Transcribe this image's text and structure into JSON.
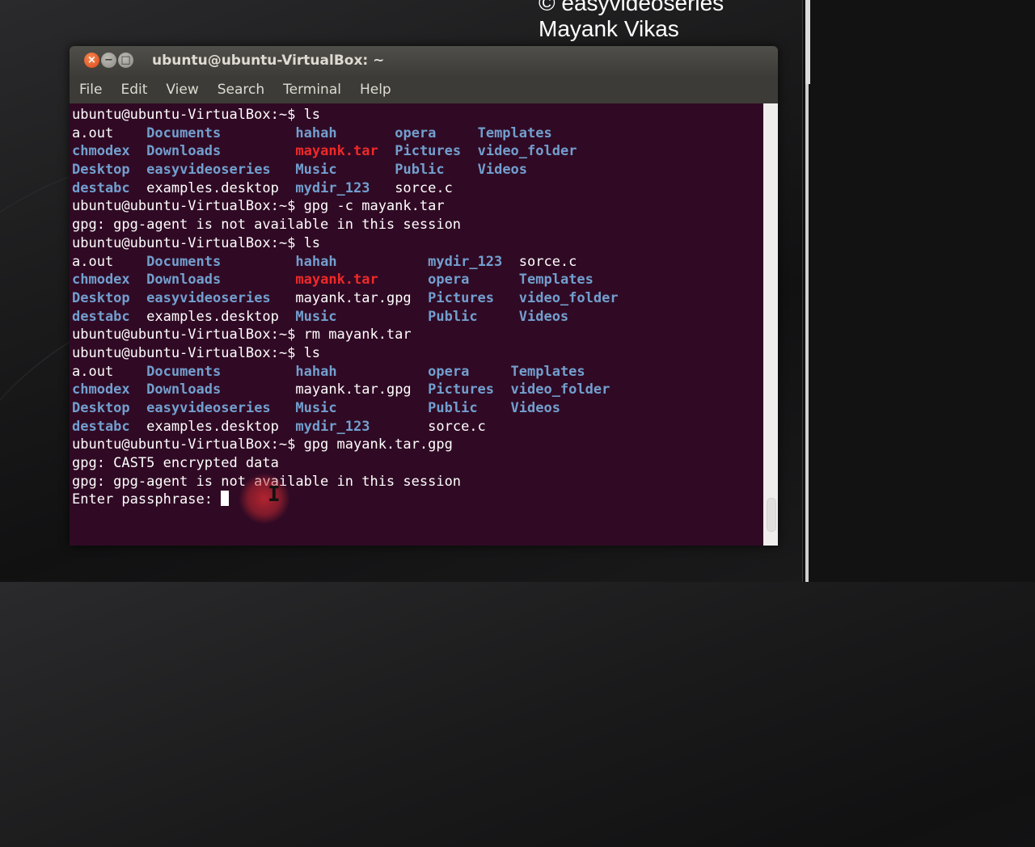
{
  "watermark": {
    "line1": "© easyvideoseries",
    "line2": "Mayank Vikas"
  },
  "window": {
    "title": "ubuntu@ubuntu-VirtualBox: ~",
    "buttons": [
      "close",
      "minimize",
      "maximize"
    ]
  },
  "menu": [
    "File",
    "Edit",
    "View",
    "Search",
    "Terminal",
    "Help"
  ],
  "colors": {
    "terminal_bg": "#300a24",
    "directory": "#729fcf",
    "archive": "#ef2929",
    "text": "#ffffff"
  },
  "terminal": {
    "lines": [
      [
        {
          "t": "ubuntu@ubuntu-VirtualBox:~$ ls"
        }
      ],
      [
        {
          "t": "a.out    "
        },
        {
          "t": "Documents",
          "c": "dir"
        },
        {
          "t": "         "
        },
        {
          "t": "hahah",
          "c": "dir"
        },
        {
          "t": "       "
        },
        {
          "t": "opera",
          "c": "dir"
        },
        {
          "t": "     "
        },
        {
          "t": "Templates",
          "c": "dir"
        }
      ],
      [
        {
          "t": "chmodex",
          "c": "dir"
        },
        {
          "t": "  "
        },
        {
          "t": "Downloads",
          "c": "dir"
        },
        {
          "t": "         "
        },
        {
          "t": "mayank.tar",
          "c": "arch"
        },
        {
          "t": "  "
        },
        {
          "t": "Pictures",
          "c": "dir"
        },
        {
          "t": "  "
        },
        {
          "t": "video_folder",
          "c": "dir"
        }
      ],
      [
        {
          "t": "Desktop",
          "c": "dir"
        },
        {
          "t": "  "
        },
        {
          "t": "easyvideoseries",
          "c": "dir"
        },
        {
          "t": "   "
        },
        {
          "t": "Music",
          "c": "dir"
        },
        {
          "t": "       "
        },
        {
          "t": "Public",
          "c": "dir"
        },
        {
          "t": "    "
        },
        {
          "t": "Videos",
          "c": "dir"
        }
      ],
      [
        {
          "t": "destabc",
          "c": "dir"
        },
        {
          "t": "  examples.desktop  "
        },
        {
          "t": "mydir_123",
          "c": "dir"
        },
        {
          "t": "   sorce.c"
        }
      ],
      [
        {
          "t": "ubuntu@ubuntu-VirtualBox:~$ gpg -c mayank.tar"
        }
      ],
      [
        {
          "t": "gpg: gpg-agent is not available in this session"
        }
      ],
      [
        {
          "t": "ubuntu@ubuntu-VirtualBox:~$ ls"
        }
      ],
      [
        {
          "t": "a.out    "
        },
        {
          "t": "Documents",
          "c": "dir"
        },
        {
          "t": "         "
        },
        {
          "t": "hahah",
          "c": "dir"
        },
        {
          "t": "           "
        },
        {
          "t": "mydir_123",
          "c": "dir"
        },
        {
          "t": "  sorce.c"
        }
      ],
      [
        {
          "t": "chmodex",
          "c": "dir"
        },
        {
          "t": "  "
        },
        {
          "t": "Downloads",
          "c": "dir"
        },
        {
          "t": "         "
        },
        {
          "t": "mayank.tar",
          "c": "arch"
        },
        {
          "t": "      "
        },
        {
          "t": "opera",
          "c": "dir"
        },
        {
          "t": "      "
        },
        {
          "t": "Templates",
          "c": "dir"
        }
      ],
      [
        {
          "t": "Desktop",
          "c": "dir"
        },
        {
          "t": "  "
        },
        {
          "t": "easyvideoseries",
          "c": "dir"
        },
        {
          "t": "   mayank.tar.gpg  "
        },
        {
          "t": "Pictures",
          "c": "dir"
        },
        {
          "t": "   "
        },
        {
          "t": "video_folder",
          "c": "dir"
        }
      ],
      [
        {
          "t": "destabc",
          "c": "dir"
        },
        {
          "t": "  examples.desktop  "
        },
        {
          "t": "Music",
          "c": "dir"
        },
        {
          "t": "           "
        },
        {
          "t": "Public",
          "c": "dir"
        },
        {
          "t": "     "
        },
        {
          "t": "Videos",
          "c": "dir"
        }
      ],
      [
        {
          "t": "ubuntu@ubuntu-VirtualBox:~$ rm mayank.tar"
        }
      ],
      [
        {
          "t": "ubuntu@ubuntu-VirtualBox:~$ ls"
        }
      ],
      [
        {
          "t": "a.out    "
        },
        {
          "t": "Documents",
          "c": "dir"
        },
        {
          "t": "         "
        },
        {
          "t": "hahah",
          "c": "dir"
        },
        {
          "t": "           "
        },
        {
          "t": "opera",
          "c": "dir"
        },
        {
          "t": "     "
        },
        {
          "t": "Templates",
          "c": "dir"
        }
      ],
      [
        {
          "t": "chmodex",
          "c": "dir"
        },
        {
          "t": "  "
        },
        {
          "t": "Downloads",
          "c": "dir"
        },
        {
          "t": "         mayank.tar.gpg  "
        },
        {
          "t": "Pictures",
          "c": "dir"
        },
        {
          "t": "  "
        },
        {
          "t": "video_folder",
          "c": "dir"
        }
      ],
      [
        {
          "t": "Desktop",
          "c": "dir"
        },
        {
          "t": "  "
        },
        {
          "t": "easyvideoseries",
          "c": "dir"
        },
        {
          "t": "   "
        },
        {
          "t": "Music",
          "c": "dir"
        },
        {
          "t": "           "
        },
        {
          "t": "Public",
          "c": "dir"
        },
        {
          "t": "    "
        },
        {
          "t": "Videos",
          "c": "dir"
        }
      ],
      [
        {
          "t": "destabc",
          "c": "dir"
        },
        {
          "t": "  examples.desktop  "
        },
        {
          "t": "mydir_123",
          "c": "dir"
        },
        {
          "t": "       sorce.c"
        }
      ],
      [
        {
          "t": "ubuntu@ubuntu-VirtualBox:~$ gpg mayank.tar.gpg"
        }
      ],
      [
        {
          "t": "gpg: CAST5 encrypted data"
        }
      ],
      [
        {
          "t": "gpg: gpg-agent is not available in this session"
        }
      ],
      [
        {
          "t": "Enter passphrase: "
        },
        {
          "cursor": true
        }
      ]
    ]
  }
}
